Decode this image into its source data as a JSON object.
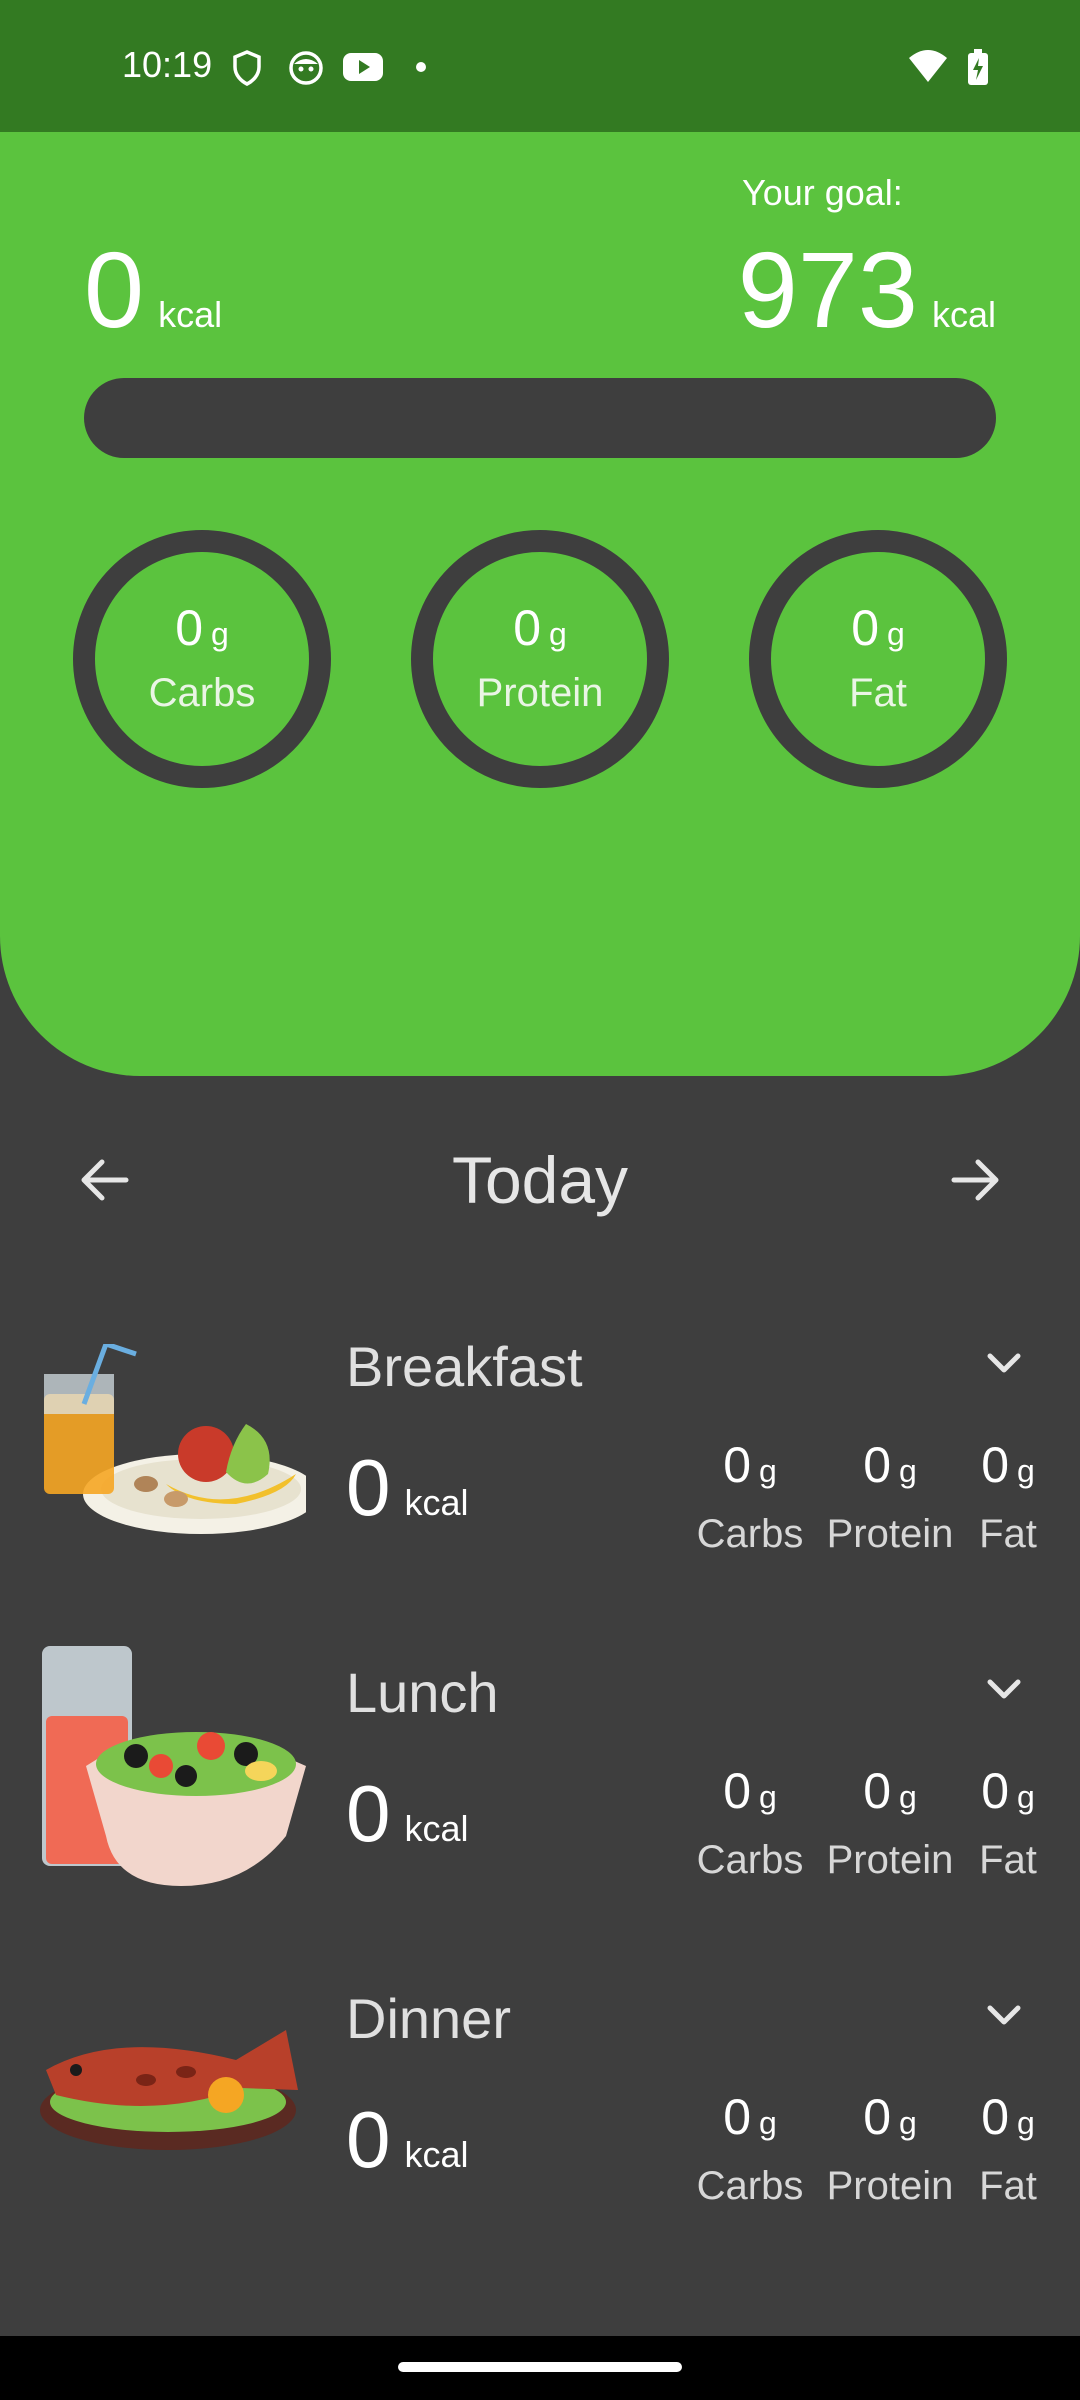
{
  "status_bar": {
    "time": "10:19"
  },
  "summary": {
    "consumed_value": "0",
    "consumed_unit": "kcal",
    "goal_label": "Your goal:",
    "goal_value": "973",
    "goal_unit": "kcal",
    "progress_fraction": 0
  },
  "macros": [
    {
      "value": "0",
      "unit": "g",
      "label": "Carbs"
    },
    {
      "value": "0",
      "unit": "g",
      "label": "Protein"
    },
    {
      "value": "0",
      "unit": "g",
      "label": "Fat"
    }
  ],
  "day_nav": {
    "title": "Today"
  },
  "meals": [
    {
      "name": "Breakfast",
      "kcal": "0",
      "kcal_unit": "kcal",
      "macros": [
        {
          "value": "0",
          "unit": "g",
          "label": "Carbs"
        },
        {
          "value": "0",
          "unit": "g",
          "label": "Protein"
        },
        {
          "value": "0",
          "unit": "g",
          "label": "Fat"
        }
      ]
    },
    {
      "name": "Lunch",
      "kcal": "0",
      "kcal_unit": "kcal",
      "macros": [
        {
          "value": "0",
          "unit": "g",
          "label": "Carbs"
        },
        {
          "value": "0",
          "unit": "g",
          "label": "Protein"
        },
        {
          "value": "0",
          "unit": "g",
          "label": "Fat"
        }
      ]
    },
    {
      "name": "Dinner",
      "kcal": "0",
      "kcal_unit": "kcal",
      "macros": [
        {
          "value": "0",
          "unit": "g",
          "label": "Carbs"
        },
        {
          "value": "0",
          "unit": "g",
          "label": "Protein"
        },
        {
          "value": "0",
          "unit": "g",
          "label": "Fat"
        }
      ]
    }
  ],
  "icons": {
    "status": [
      "shield-icon",
      "face-icon",
      "youtube-icon",
      "dot-icon",
      "wifi-icon",
      "battery-charging-icon"
    ],
    "nav": [
      "arrow-left-icon",
      "arrow-right-icon",
      "chevron-down-icon"
    ]
  },
  "colors": {
    "header_green": "#5bc33e",
    "status_green": "#337a22",
    "background": "#3e3e3e"
  }
}
